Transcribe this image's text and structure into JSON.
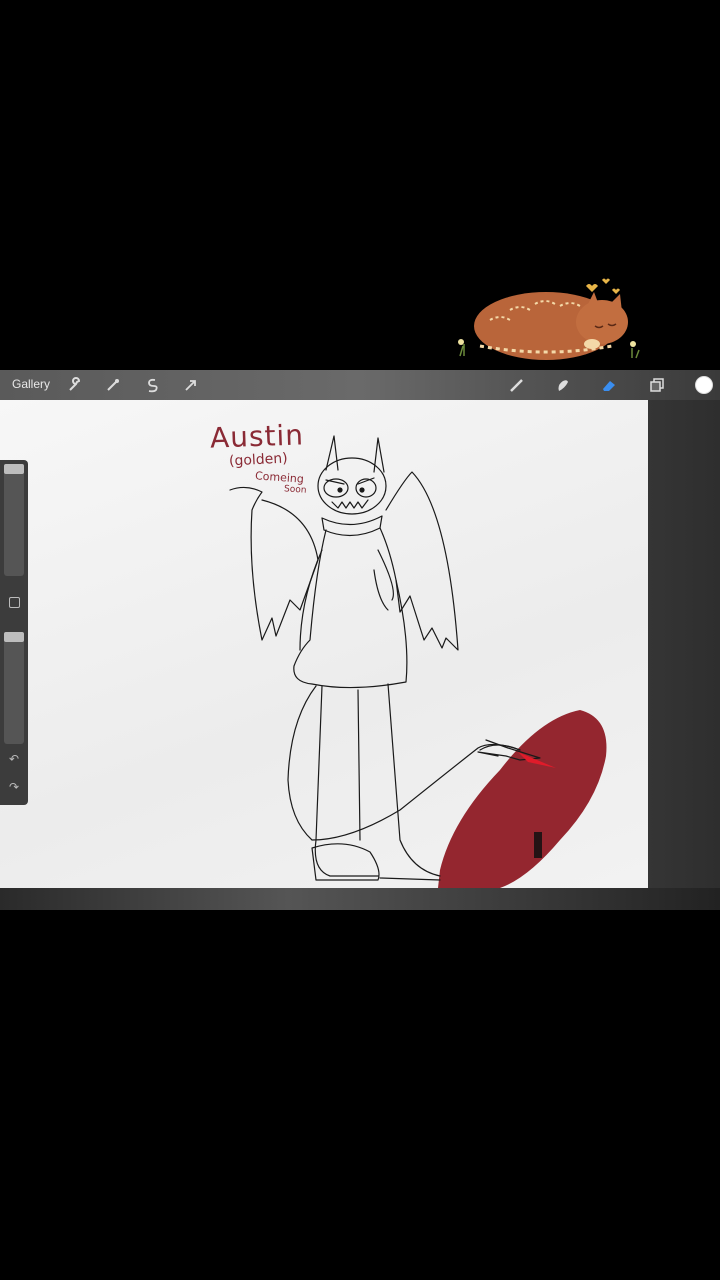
{
  "toolbar": {
    "gallery_label": "Gallery",
    "left_tools": [
      "wrench-icon",
      "magic-wand-icon",
      "selection-icon",
      "transform-arrow-icon"
    ],
    "right_tools": [
      "brush-icon",
      "smudge-icon",
      "eraser-icon",
      "layers-icon"
    ],
    "active_tool": "eraser-icon",
    "active_color": "#ffffff"
  },
  "sidebar": {
    "controls": [
      "brush-size-slider",
      "modify-button",
      "opacity-slider",
      "undo-icon",
      "redo-icon"
    ]
  },
  "canvas": {
    "note_title": "Austin",
    "note_subtitle": "(golden)",
    "note_line1": "Comeing",
    "note_line2": "Soon",
    "brush_color": "#8e1a24"
  },
  "sticker": {
    "description_icon": "sleeping-cat-sticker"
  }
}
